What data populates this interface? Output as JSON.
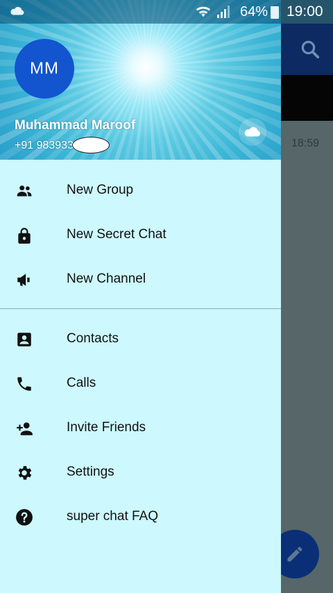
{
  "status_bar": {
    "battery": "64%",
    "time": "19:00"
  },
  "background_app": {
    "chat_time": "18:59"
  },
  "drawer": {
    "avatar_initials": "MM",
    "user_name": "Muhammad Maroof",
    "phone": "+91 983933",
    "menu_group_1": [
      {
        "label": "New Group",
        "icon": "group-icon"
      },
      {
        "label": "New Secret Chat",
        "icon": "lock-icon"
      },
      {
        "label": "New Channel",
        "icon": "megaphone-icon"
      }
    ],
    "menu_group_2": [
      {
        "label": "Contacts",
        "icon": "contacts-icon"
      },
      {
        "label": "Calls",
        "icon": "phone-icon"
      },
      {
        "label": "Invite Friends",
        "icon": "add-person-icon"
      },
      {
        "label": "Settings",
        "icon": "gear-icon"
      },
      {
        "label": "super chat FAQ",
        "icon": "help-icon"
      }
    ]
  },
  "colors": {
    "drawer_bg": "#ccf8fe",
    "avatar": "#1255cf",
    "toolbar": "#0d2a63",
    "fab": "#0b2f77"
  }
}
